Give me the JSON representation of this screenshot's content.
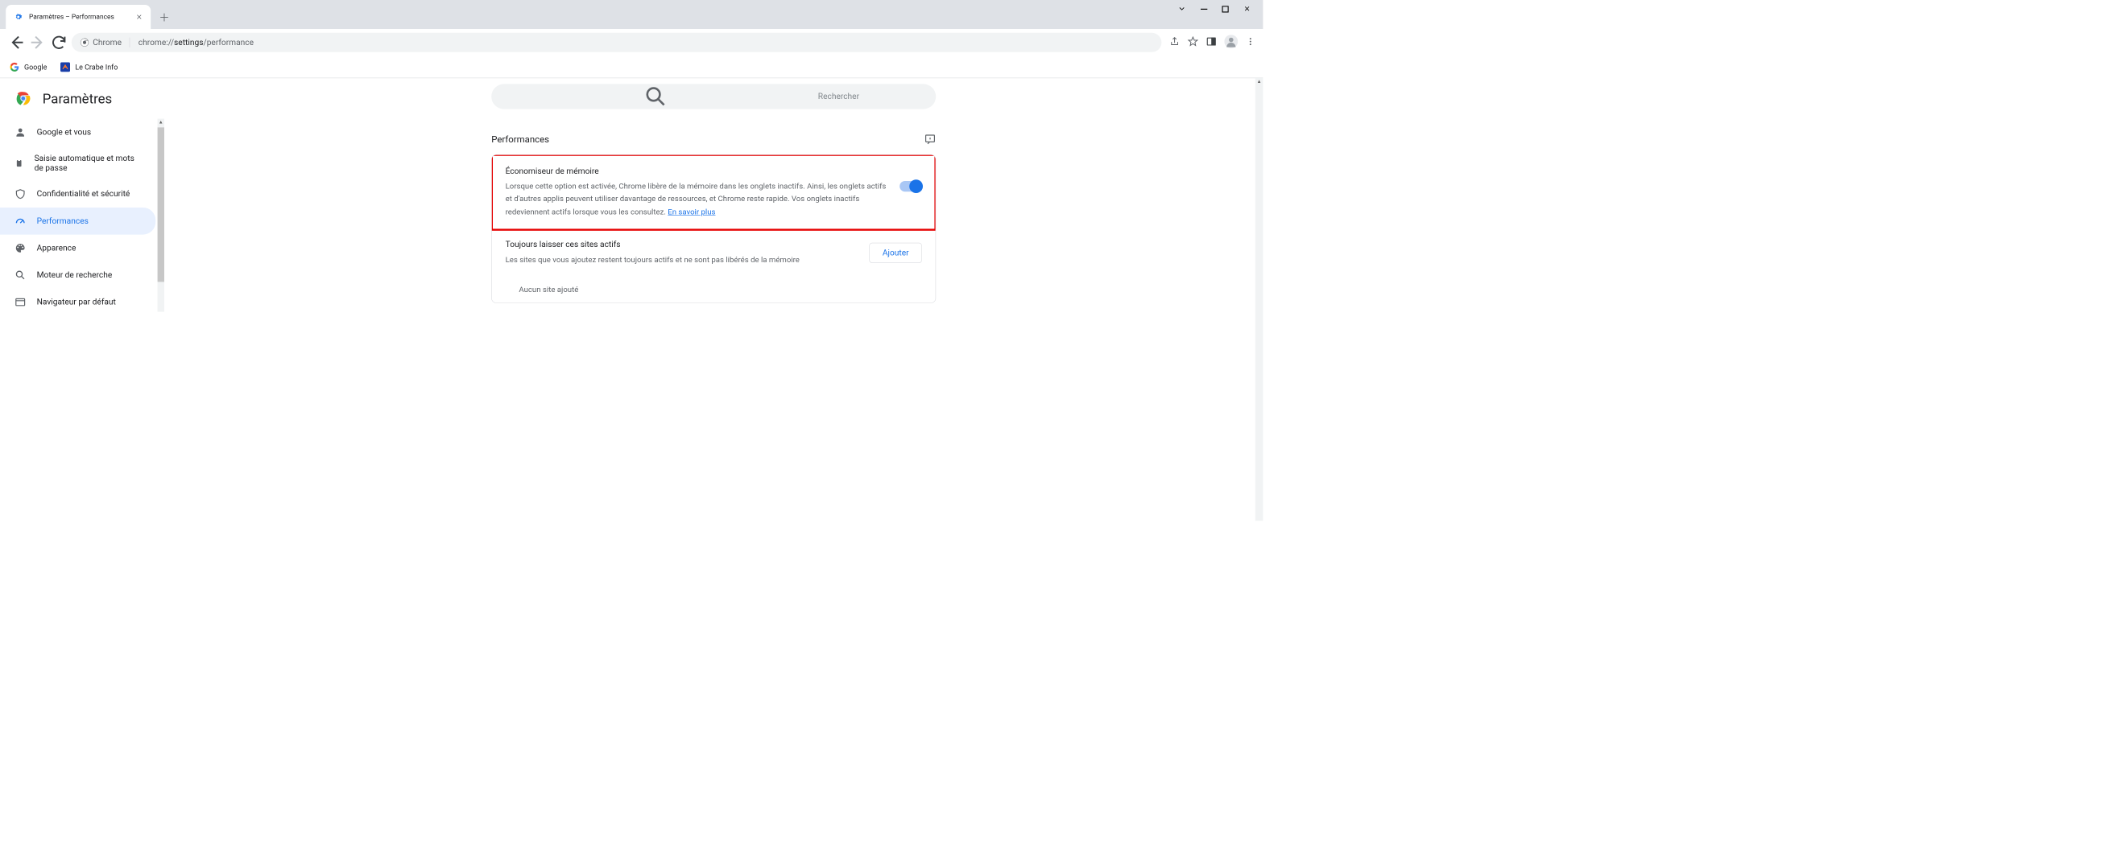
{
  "tab": {
    "title": "Paramètres – Performances"
  },
  "omnibox": {
    "chip": "Chrome",
    "url_strong": "settings",
    "url_prefix": "chrome://",
    "url_suffix": "/performance"
  },
  "bookmarks": [
    {
      "label": "Google"
    },
    {
      "label": "Le Crabe Info"
    }
  ],
  "brand": "Paramètres",
  "search": {
    "placeholder": "Rechercher"
  },
  "sidebar": {
    "items": [
      {
        "label": "Google et vous"
      },
      {
        "label": "Saisie automatique et mots de passe"
      },
      {
        "label": "Confidentialité et sécurité"
      },
      {
        "label": "Performances"
      },
      {
        "label": "Apparence"
      },
      {
        "label": "Moteur de recherche"
      },
      {
        "label": "Navigateur par défaut"
      }
    ]
  },
  "section": {
    "title": "Performances"
  },
  "memory": {
    "title": "Économiseur de mémoire",
    "desc": "Lorsque cette option est activée, Chrome libère de la mémoire dans les onglets inactifs. Ainsi, les onglets actifs et d'autres applis peuvent utiliser davantage de ressources, et Chrome reste rapide. Vos onglets inactifs redeviennent actifs lorsque vous les consultez. ",
    "learn": "En savoir plus"
  },
  "always": {
    "title": "Toujours laisser ces sites actifs",
    "desc": "Les sites que vous ajoutez restent toujours actifs et ne sont pas libérés de la mémoire",
    "add": "Ajouter",
    "empty": "Aucun site ajouté"
  }
}
